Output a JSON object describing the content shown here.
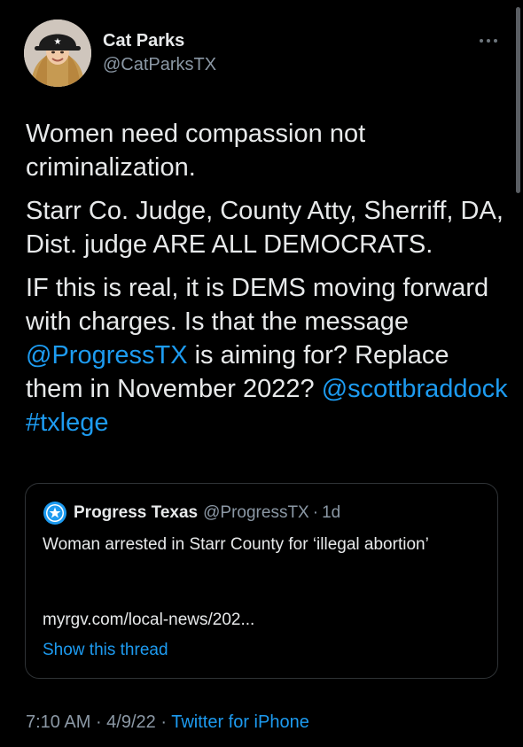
{
  "author": {
    "display_name": "Cat Parks",
    "handle": "@CatParksTX",
    "avatar_icon": "profile-photo",
    "more_icon": "more-options-icon"
  },
  "tweet": {
    "paragraphs": [
      {
        "segments": [
          {
            "text": "Women need compassion not criminalization.",
            "link": false
          }
        ]
      },
      {
        "segments": [
          {
            "text": "Starr Co. Judge, County Atty, Sherriff, DA, Dist. judge ARE ALL DEMOCRATS.",
            "link": false
          }
        ]
      },
      {
        "segments": [
          {
            "text": "IF this is real, it is DEMS moving forward with charges. Is that the message ",
            "link": false
          },
          {
            "text": "@ProgressTX",
            "link": true
          },
          {
            "text": " is aiming for? Replace them in November 2022? ",
            "link": false
          },
          {
            "text": "@scottbraddock",
            "link": true
          },
          {
            "text": " ",
            "link": false
          },
          {
            "text": "#txlege",
            "link": true
          }
        ]
      }
    ]
  },
  "quote": {
    "avatar_icon": "progress-texas-star-icon",
    "name": "Progress Texas",
    "handle": "@ProgressTX",
    "separator": "·",
    "time": "1d",
    "text": "Woman arrested in Starr County for ‘illegal abortion’",
    "link_text": "myrgv.com/local-news/202...",
    "thread_label": "Show this thread"
  },
  "meta": {
    "time": "7:10 AM",
    "separator": "·",
    "date": "4/9/22",
    "source": "Twitter for iPhone"
  },
  "colors": {
    "background": "#000000",
    "text": "#e7e9ea",
    "secondary": "#8b98a5",
    "accent": "#1d9bf0",
    "border": "#2f3336"
  }
}
